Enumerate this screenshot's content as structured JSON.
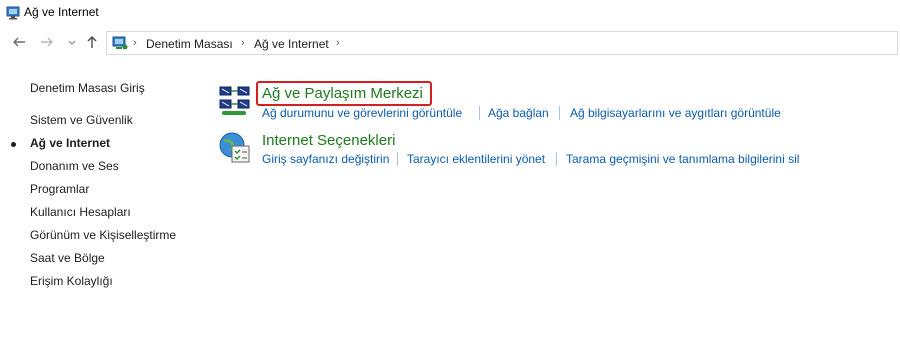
{
  "window": {
    "title": "Ağ ve Internet",
    "icon": "network-icon"
  },
  "nav": {
    "back_icon": "back-arrow-icon",
    "forward_icon": "forward-arrow-icon",
    "recent_icon": "chevron-down-icon",
    "up_icon": "up-arrow-icon"
  },
  "address": {
    "icon": "control-panel-icon",
    "crumbs": [
      "Denetim Masası",
      "Ağ ve Internet"
    ]
  },
  "sidebar": {
    "home": "Denetim Masası Giriş",
    "items": [
      {
        "label": "Sistem ve Güvenlik",
        "active": false
      },
      {
        "label": "Ağ ve Internet",
        "active": true
      },
      {
        "label": "Donanım ve Ses",
        "active": false
      },
      {
        "label": "Programlar",
        "active": false
      },
      {
        "label": "Kullanıcı Hesapları",
        "active": false
      },
      {
        "label": "Görünüm ve Kişiselleştirme",
        "active": false
      },
      {
        "label": "Saat ve Bölge",
        "active": false
      },
      {
        "label": "Erişim Kolaylığı",
        "active": false
      }
    ]
  },
  "categories": [
    {
      "title": "Ağ ve Paylaşım Merkezi",
      "icon": "network-sharing-icon",
      "highlighted": true,
      "tasks": [
        "Ağ durumunu ve görevlerini görüntüle",
        "Ağa bağlan",
        "Ağ bilgisayarlarını ve aygıtları görüntüle"
      ]
    },
    {
      "title": "Internet Seçenekleri",
      "icon": "internet-options-icon",
      "highlighted": false,
      "tasks": [
        "Giriş sayfanızı değiştirin",
        "Tarayıcı eklentilerini yönet",
        "Tarama geçmişini ve tanımlama bilgilerini sil"
      ]
    }
  ],
  "colors": {
    "category_title": "#1e7a1e",
    "link": "#0b5cad",
    "highlight_border": "#d42020"
  }
}
